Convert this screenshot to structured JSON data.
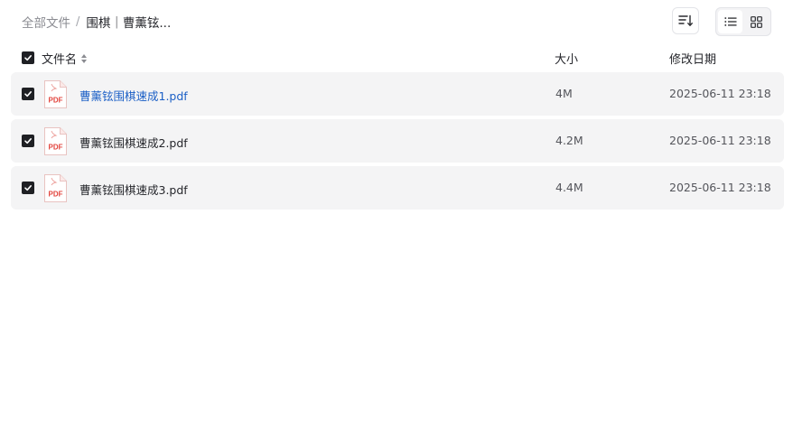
{
  "breadcrumb": {
    "root": "全部文件",
    "separator": "/",
    "current": "围棋｜曹薰铉..."
  },
  "toolbar": {
    "sort_icon": "sort-lines-icon",
    "view_list_icon": "list-view-icon",
    "view_grid_icon": "grid-view-icon",
    "active_view": "list"
  },
  "table": {
    "headers": {
      "name": "文件名",
      "size": "大小",
      "modified": "修改日期"
    },
    "rows": [
      {
        "name": "曹薰铉围棋速成1.pdf",
        "size": "4M",
        "modified": "2025-06-11 23:18",
        "icon": "pdf-file-icon"
      },
      {
        "name": "曹薰铉围棋速成2.pdf",
        "size": "4.2M",
        "modified": "2025-06-11 23:18",
        "icon": "pdf-file-icon"
      },
      {
        "name": "曹薰铉围棋速成3.pdf",
        "size": "4.4M",
        "modified": "2025-06-11 23:18",
        "icon": "pdf-file-icon"
      }
    ]
  },
  "pdf_label": "PDF",
  "colors": {
    "link": "#1b5fc6",
    "row_bg": "#f4f4f5",
    "checkbox": "#1f2024",
    "pdf_red": "#e2433c"
  }
}
